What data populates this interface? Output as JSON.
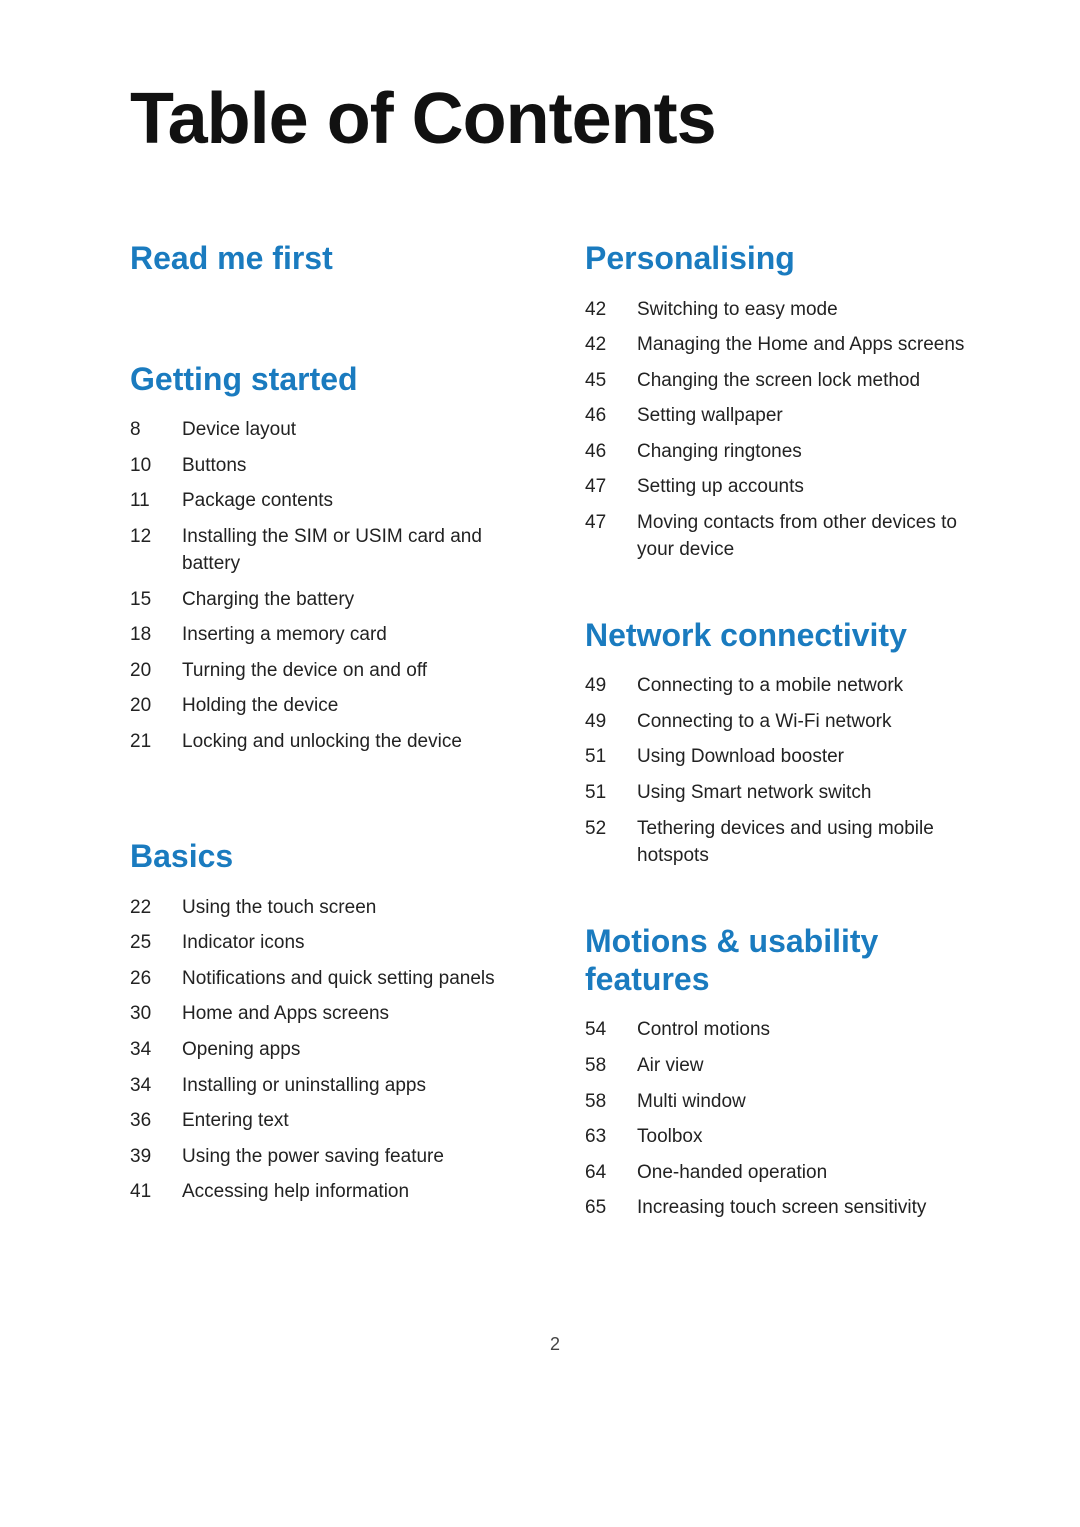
{
  "title": "Table of Contents",
  "footer": {
    "page_number": "2"
  },
  "sections": {
    "left": [
      {
        "id": "read-me-first",
        "title": "Read me first",
        "items": []
      },
      {
        "id": "getting-started",
        "title": "Getting started",
        "items": [
          {
            "page": "8",
            "text": "Device layout"
          },
          {
            "page": "10",
            "text": "Buttons"
          },
          {
            "page": "11",
            "text": "Package contents"
          },
          {
            "page": "12",
            "text": "Installing the SIM or USIM card and battery"
          },
          {
            "page": "15",
            "text": "Charging the battery"
          },
          {
            "page": "18",
            "text": "Inserting a memory card"
          },
          {
            "page": "20",
            "text": "Turning the device on and off"
          },
          {
            "page": "20",
            "text": "Holding the device"
          },
          {
            "page": "21",
            "text": "Locking and unlocking the device"
          }
        ]
      },
      {
        "id": "basics",
        "title": "Basics",
        "items": [
          {
            "page": "22",
            "text": "Using the touch screen"
          },
          {
            "page": "25",
            "text": "Indicator icons"
          },
          {
            "page": "26",
            "text": "Notifications and quick setting panels"
          },
          {
            "page": "30",
            "text": "Home and Apps screens"
          },
          {
            "page": "34",
            "text": "Opening apps"
          },
          {
            "page": "34",
            "text": "Installing or uninstalling apps"
          },
          {
            "page": "36",
            "text": "Entering text"
          },
          {
            "page": "39",
            "text": "Using the power saving feature"
          },
          {
            "page": "41",
            "text": "Accessing help information"
          }
        ]
      }
    ],
    "right": [
      {
        "id": "personalising",
        "title": "Personalising",
        "items": [
          {
            "page": "42",
            "text": "Switching to easy mode"
          },
          {
            "page": "42",
            "text": "Managing the Home and Apps screens"
          },
          {
            "page": "45",
            "text": "Changing the screen lock method"
          },
          {
            "page": "46",
            "text": "Setting wallpaper"
          },
          {
            "page": "46",
            "text": "Changing ringtones"
          },
          {
            "page": "47",
            "text": "Setting up accounts"
          },
          {
            "page": "47",
            "text": "Moving contacts from other devices to your device"
          }
        ]
      },
      {
        "id": "network-connectivity",
        "title": "Network connectivity",
        "items": [
          {
            "page": "49",
            "text": "Connecting to a mobile network"
          },
          {
            "page": "49",
            "text": "Connecting to a Wi-Fi network"
          },
          {
            "page": "51",
            "text": "Using Download booster"
          },
          {
            "page": "51",
            "text": "Using Smart network switch"
          },
          {
            "page": "52",
            "text": "Tethering devices and using mobile hotspots"
          }
        ]
      },
      {
        "id": "motions-usability",
        "title": "Motions & usability features",
        "items": [
          {
            "page": "54",
            "text": "Control motions"
          },
          {
            "page": "58",
            "text": "Air view"
          },
          {
            "page": "58",
            "text": "Multi window"
          },
          {
            "page": "63",
            "text": "Toolbox"
          },
          {
            "page": "64",
            "text": "One-handed operation"
          },
          {
            "page": "65",
            "text": "Increasing touch screen sensitivity"
          }
        ]
      }
    ]
  }
}
